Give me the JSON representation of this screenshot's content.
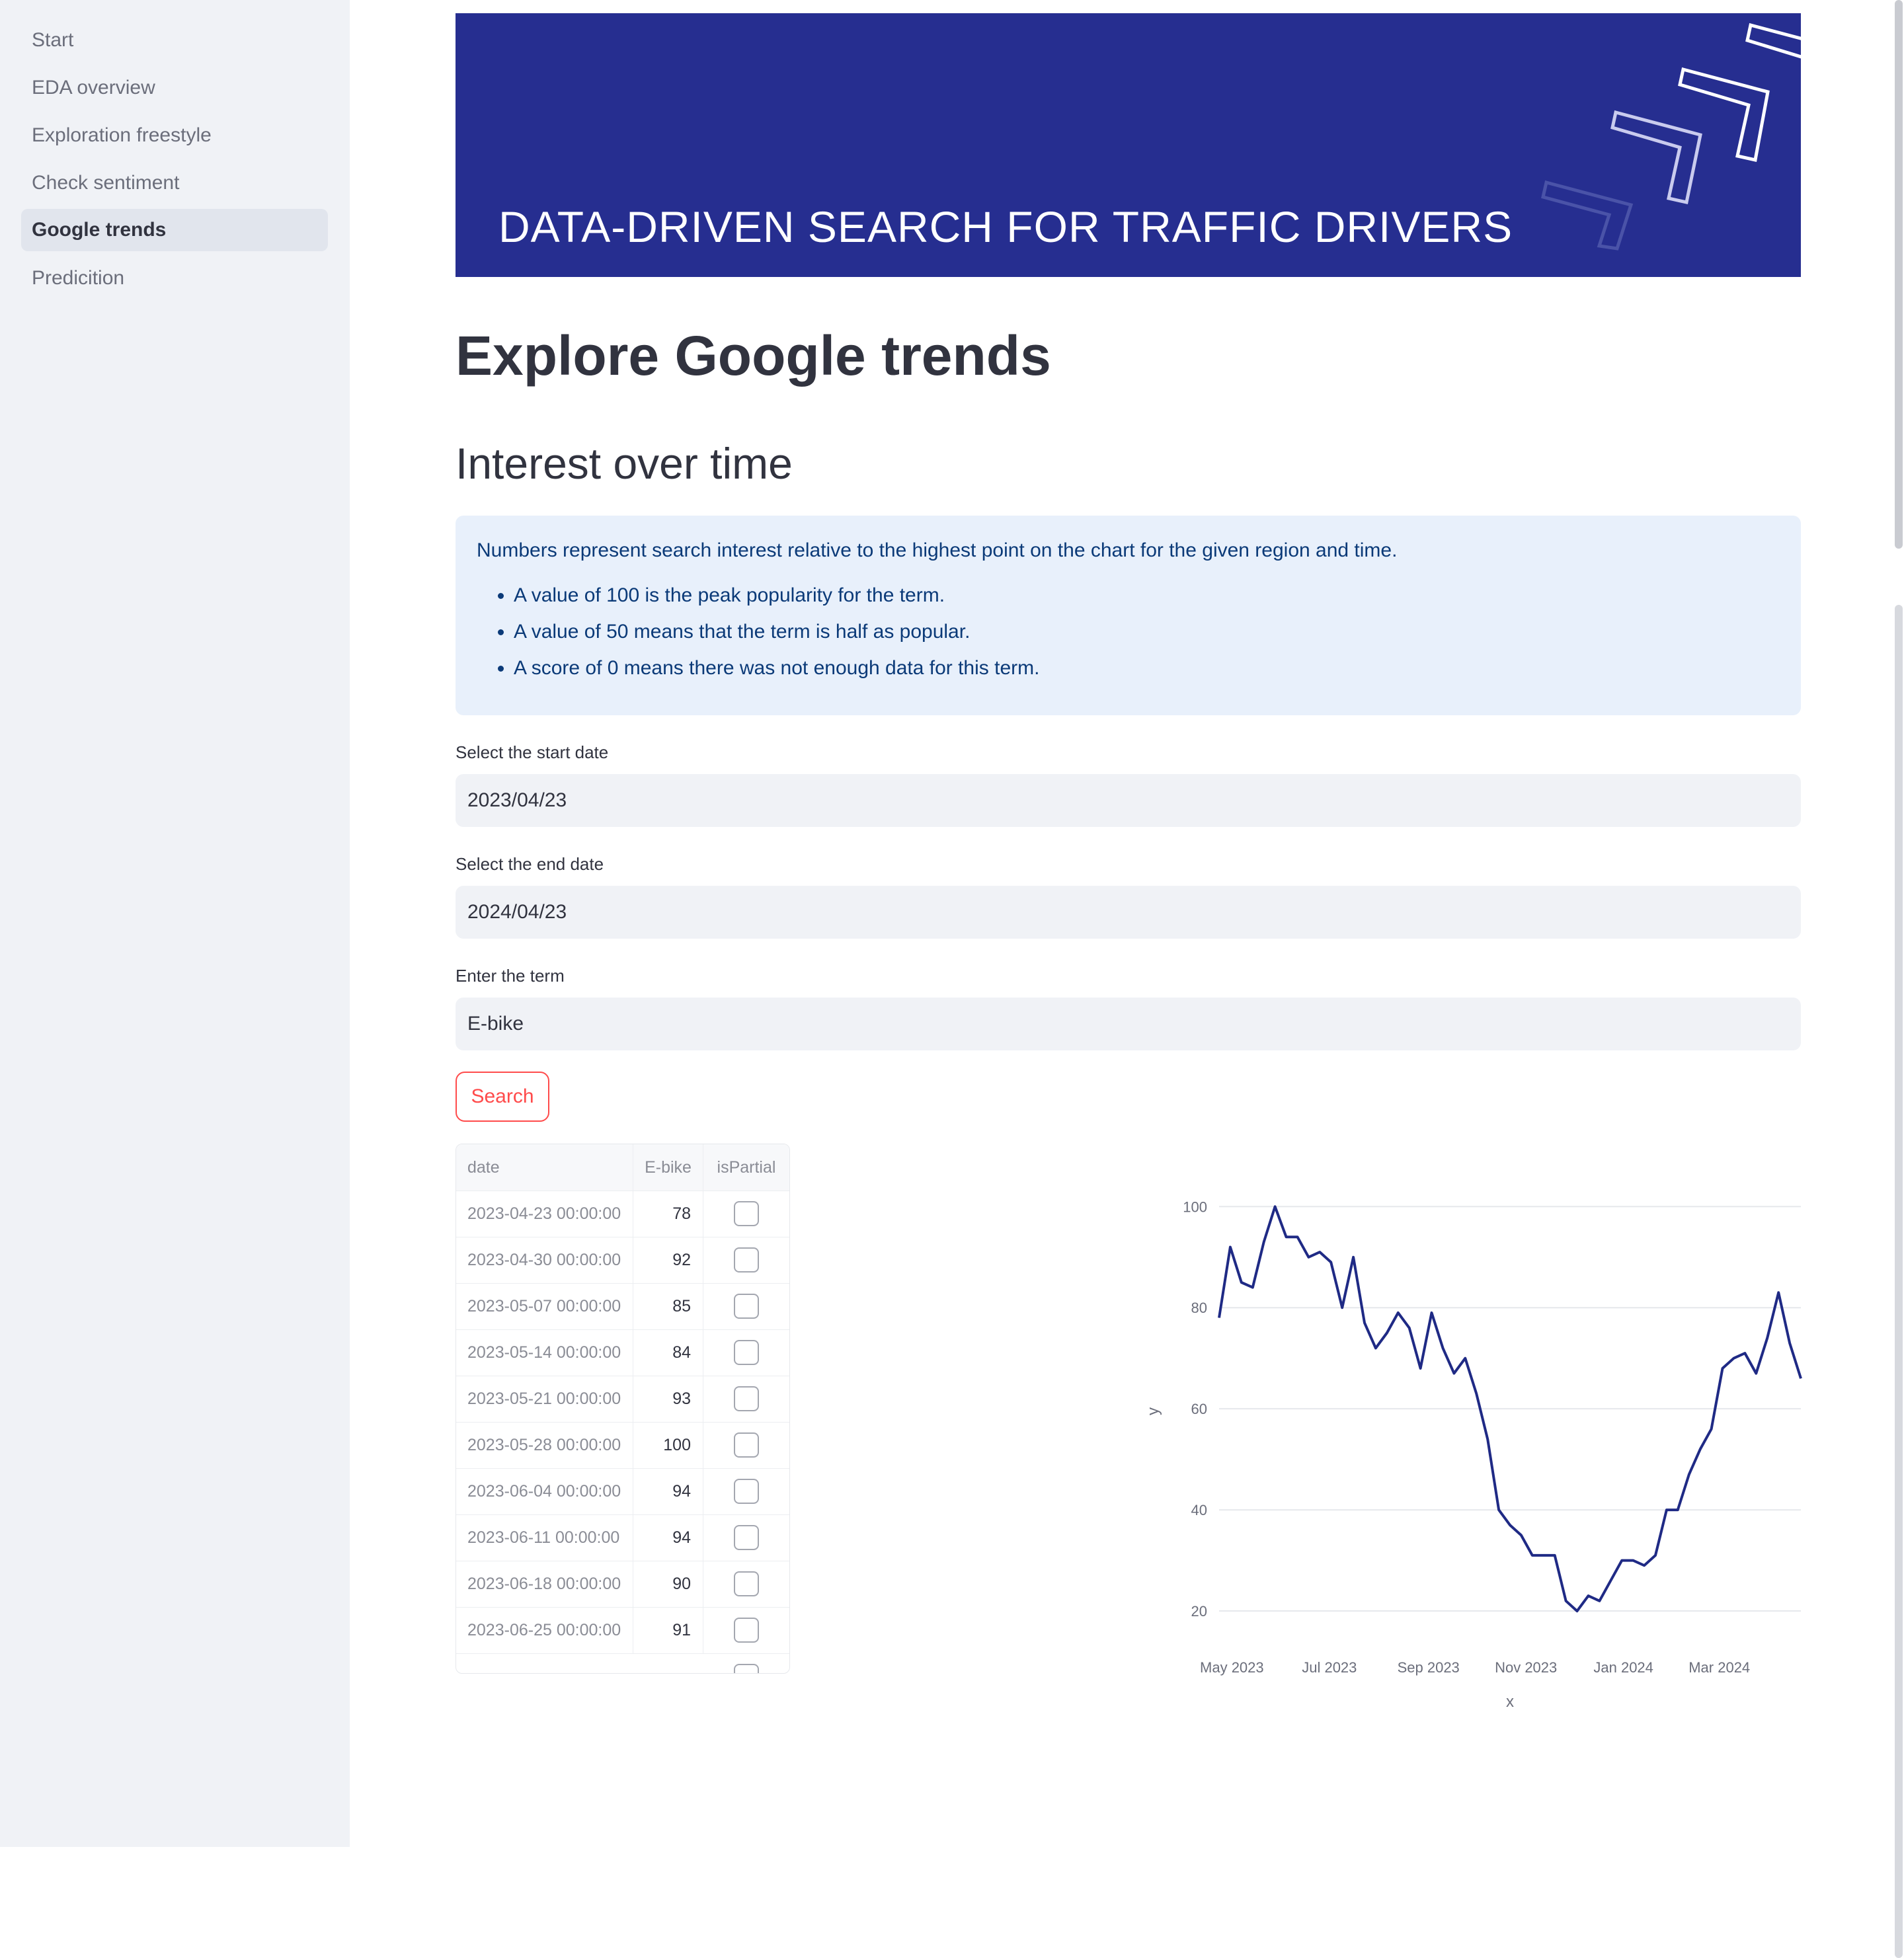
{
  "sidebar": {
    "items": [
      {
        "label": "Start",
        "active": false
      },
      {
        "label": "EDA overview",
        "active": false
      },
      {
        "label": "Exploration freestyle",
        "active": false
      },
      {
        "label": "Check sentiment",
        "active": false
      },
      {
        "label": "Google trends",
        "active": true
      },
      {
        "label": "Predicition",
        "active": false
      }
    ]
  },
  "banner": {
    "text": "DATA-DRIVEN SEARCH FOR TRAFFIC DRIVERS",
    "background": "#262e90"
  },
  "page": {
    "title": "Explore Google trends",
    "subtitle": "Interest over time"
  },
  "info": {
    "intro": "Numbers represent search interest relative to the highest point on the chart for the given region and time.",
    "bullets": [
      "A value of 100 is the peak popularity for the term.",
      "A value of 50 means that the term is half as popular.",
      "A score of 0 means there was not enough data for this term."
    ]
  },
  "form": {
    "start_label": "Select the start date",
    "start_value": "2023/04/23",
    "end_label": "Select the end date",
    "end_value": "2024/04/23",
    "term_label": "Enter the term",
    "term_value": "E-bike",
    "search_label": "Search"
  },
  "table": {
    "columns": [
      "date",
      "E-bike",
      "isPartial"
    ],
    "rows": [
      {
        "date": "2023-04-23 00:00:00",
        "value": "78",
        "isPartial": false
      },
      {
        "date": "2023-04-30 00:00:00",
        "value": "92",
        "isPartial": false
      },
      {
        "date": "2023-05-07 00:00:00",
        "value": "85",
        "isPartial": false
      },
      {
        "date": "2023-05-14 00:00:00",
        "value": "84",
        "isPartial": false
      },
      {
        "date": "2023-05-21 00:00:00",
        "value": "93",
        "isPartial": false
      },
      {
        "date": "2023-05-28 00:00:00",
        "value": "100",
        "isPartial": false
      },
      {
        "date": "2023-06-04 00:00:00",
        "value": "94",
        "isPartial": false
      },
      {
        "date": "2023-06-11 00:00:00",
        "value": "94",
        "isPartial": false
      },
      {
        "date": "2023-06-18 00:00:00",
        "value": "90",
        "isPartial": false
      },
      {
        "date": "2023-06-25 00:00:00",
        "value": "91",
        "isPartial": false
      }
    ]
  },
  "chart_data": {
    "type": "line",
    "xlabel": "x",
    "ylabel": "y",
    "ylim": [
      17,
      102
    ],
    "yticks": [
      20,
      40,
      60,
      80,
      100
    ],
    "xticks": [
      "May 2023",
      "Jul 2023",
      "Sep 2023",
      "Nov 2023",
      "Jan 2024",
      "Mar 2024"
    ],
    "xtick_dates": [
      "2023-05-01",
      "2023-07-01",
      "2023-09-01",
      "2023-11-01",
      "2024-01-01",
      "2024-03-01"
    ],
    "xlim": [
      "2023-04-23",
      "2024-04-21"
    ],
    "grid": true,
    "color": "#1f2a85",
    "series": [
      {
        "x": [
          "2023-04-23",
          "2023-04-30",
          "2023-05-07",
          "2023-05-14",
          "2023-05-21",
          "2023-05-28",
          "2023-06-04",
          "2023-06-11",
          "2023-06-18",
          "2023-06-25",
          "2023-07-02",
          "2023-07-09",
          "2023-07-16",
          "2023-07-23",
          "2023-07-30",
          "2023-08-06",
          "2023-08-13",
          "2023-08-20",
          "2023-08-27",
          "2023-09-03",
          "2023-09-10",
          "2023-09-17",
          "2023-09-24",
          "2023-10-01",
          "2023-10-08",
          "2023-10-15",
          "2023-10-22",
          "2023-10-29",
          "2023-11-05",
          "2023-11-12",
          "2023-11-19",
          "2023-11-26",
          "2023-12-03",
          "2023-12-10",
          "2023-12-17",
          "2023-12-24",
          "2023-12-31",
          "2024-01-07",
          "2024-01-14",
          "2024-01-21",
          "2024-01-28",
          "2024-02-04",
          "2024-02-11",
          "2024-02-18",
          "2024-02-25",
          "2024-03-03",
          "2024-03-10",
          "2024-03-17",
          "2024-03-24",
          "2024-03-31",
          "2024-04-07",
          "2024-04-14",
          "2024-04-21"
        ],
        "values": [
          78,
          92,
          85,
          84,
          93,
          100,
          94,
          94,
          90,
          91,
          89,
          80,
          90,
          77,
          72,
          75,
          79,
          76,
          68,
          79,
          72,
          67,
          70,
          63,
          54,
          40,
          37,
          35,
          31,
          31,
          31,
          22,
          20,
          23,
          22,
          26,
          30,
          30,
          29,
          31,
          40,
          40,
          47,
          52,
          56,
          68,
          70,
          71,
          67,
          74,
          83,
          73,
          66
        ]
      }
    ]
  }
}
